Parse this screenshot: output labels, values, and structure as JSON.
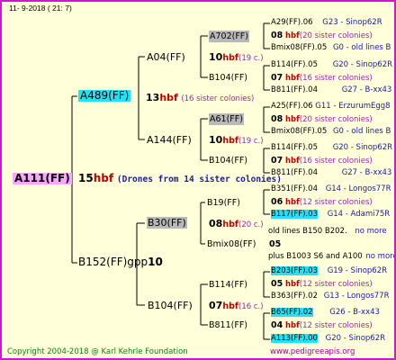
{
  "header": {
    "date": "11-  9-2018 (  21:  7)"
  },
  "root": {
    "name": "A111(FF)"
  },
  "gen1": {
    "num": "15",
    "hbf": "hbf",
    "note": "(Drones from 14 sister colonies)",
    "upper": {
      "name": "A489(FF)"
    },
    "lower": {
      "name": "B152(FF)gpp",
      "num": "10"
    }
  },
  "gen2": [
    {
      "name": "A04(FF)",
      "num": "13",
      "hbf": "hbf",
      "note": "(16 sister colonies)"
    },
    {
      "name": "A144(FF)"
    },
    {
      "name": "B30(FF)",
      "num": "08",
      "hbf": "hbf",
      "note": "(20 c.)"
    },
    {
      "name": "B104(FF)",
      "num": "07",
      "hbf": "hbf",
      "note": "(16 c.)"
    }
  ],
  "gen3": [
    {
      "name": "A702(FF)",
      "num": "10",
      "hbf": "hbf",
      "note": "(19 c.)"
    },
    {
      "name": "B104(FF)"
    },
    {
      "name": "A61(FF)",
      "num": "10",
      "hbf": "hbf",
      "note": "(19 c.)"
    },
    {
      "name": "B104(FF)"
    },
    {
      "name": "B19(FF)",
      "num": "08",
      "hbf": "hbf",
      "note": "(20 c.)"
    },
    {
      "name": "Bmix08(FF)",
      "num": "05",
      "hbf": ""
    },
    {
      "name": "B114(FF)",
      "num": "07",
      "hbf": "hbf",
      "note": "(16 c.)"
    },
    {
      "name": "B811(FF)"
    }
  ],
  "gen4": [
    {
      "name": "A29(FF).06",
      "info": "G23 - Sinop62R"
    },
    {
      "num": "08",
      "hbf": "hbf",
      "note": "(20 sister colonies)"
    },
    {
      "name": "Bmix08(FF).05",
      "info": "G0 - old lines B"
    },
    {
      "name": "B114(FF).05",
      "info": "G20 - Sinop62R"
    },
    {
      "num": "07",
      "hbf": "hbf",
      "note": "(16 sister colonies)"
    },
    {
      "name": "B811(FF).04",
      "info": "G27 - B-xx43"
    },
    {
      "name": "A25(FF).06",
      "info": "G11 - ErzurumEgg8"
    },
    {
      "num": "08",
      "hbf": "hbf",
      "note": "(20 sister colonies)"
    },
    {
      "name": "Bmix08(FF).05",
      "info": "G0 - old lines B"
    },
    {
      "name": "B114(FF).05",
      "info": "G20 - Sinop62R"
    },
    {
      "num": "07",
      "hbf": "hbf",
      "note": "(16 sister colonies)"
    },
    {
      "name": "B811(FF).04",
      "info": "G27 - B-xx43"
    },
    {
      "name": "B351(FF).04",
      "info": "G14 - Longos77R"
    },
    {
      "num": "06",
      "hbf": "hbf",
      "note": "(12 sister colonies)"
    },
    {
      "name": "B117(FF).03",
      "info": "G14 - Adami75R"
    },
    {
      "name": "old lines B150 B202.",
      "info": "no more"
    },
    {
      "name": "plus B1003 S6 and A100",
      "info": "no more"
    },
    {
      "name": "B203(FF).03",
      "info": "G19 - Sinop62R"
    },
    {
      "num": "05",
      "hbf": "hbf",
      "note": "(12 sister colonies)"
    },
    {
      "name": "B363(FF).02",
      "info": "G13 - Longos77R"
    },
    {
      "name": "B65(FF).02",
      "info": "G26 - B-xx43"
    },
    {
      "num": "04",
      "hbf": "hbf",
      "note": "(12 sister colonies)"
    },
    {
      "name": "A113(FF).00",
      "info": "G20 - Sinop62R"
    }
  ],
  "footer": {
    "copyright": "Copyright 2004-2018 @ Karl Kehrle Foundation",
    "site": "www.pedigreeapis.org"
  },
  "colors": {
    "frame": "#d016d0",
    "background": "#ffffd9",
    "hbf": "#c00000",
    "sister": "#9c27b0",
    "info": "#1a1aa6",
    "pink": "#f7a8f7",
    "cyan": "#23e2f5",
    "gray": "#b9b9b9",
    "footer": "#108010"
  }
}
